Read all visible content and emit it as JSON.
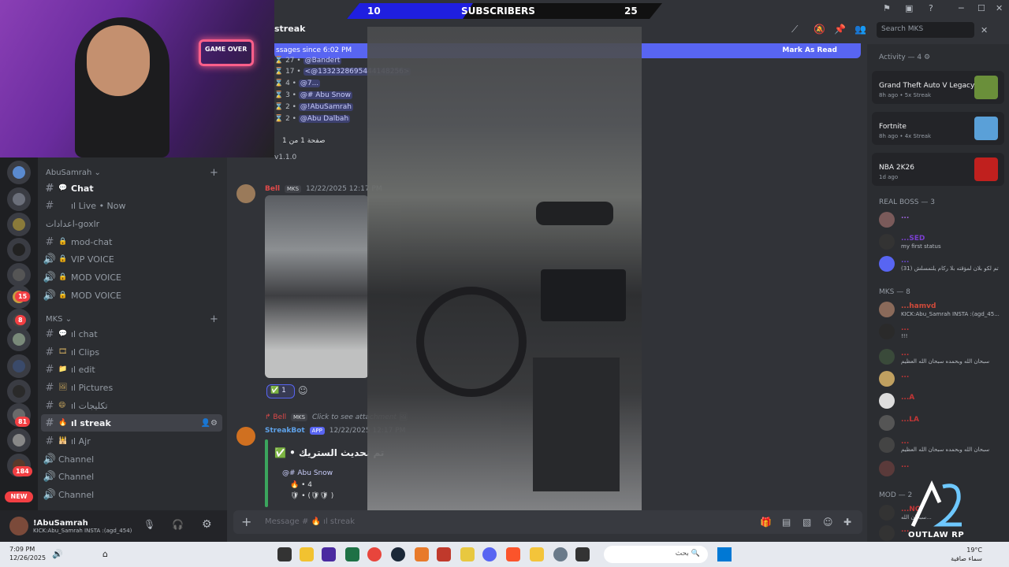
{
  "stream": {
    "subscribers": {
      "label": "SUBSCRIBERS",
      "current": "10",
      "goal": "25",
      "progress_fraction": 0.4
    },
    "logo_text": "OUTLAW RP",
    "neon_sign": "GAME OVER"
  },
  "window": {
    "search_placeholder": "Search MKS"
  },
  "channel_header": {
    "name": "streak"
  },
  "new_messages": {
    "text": "ssages since 6:02 PM",
    "action": "Mark As Read"
  },
  "leaderboard": [
    {
      "rank": "27",
      "name": "@Bandert"
    },
    {
      "rank": "17",
      "name": "<@1332328695444148256>"
    },
    {
      "rank": "4",
      "name": "@7..."
    },
    {
      "rank": "3",
      "name": "@# Abu Snow"
    },
    {
      "rank": "2",
      "name": "@!AbuSamrah"
    },
    {
      "rank": "2",
      "name": "@Abu Dalbah"
    }
  ],
  "leaderboard_page": "صفحة 1 من 1",
  "leaderboard_version": "v1.1.0",
  "messages": [
    {
      "author": "Bell",
      "tag": "MKS",
      "time": "12/22/2025 12:17 PM",
      "reaction_count": "1"
    },
    {
      "author": "StreakBot",
      "app_tag": "APP",
      "time": "12/22/2025 12:17 PM",
      "reply_tag": "MKS",
      "reply_text": "Click to see attachment",
      "title": "تم تحديث الستريك",
      "mention": "@# Abu Snow",
      "line1": "4",
      "line2": ")"
    }
  ],
  "sidebar": {
    "server_badges": [
      "15",
      "8",
      "81",
      "184"
    ],
    "new_label": "NEW",
    "category1": "AbuSamrah",
    "category2": "MKS",
    "channels": [
      {
        "label": "Chat",
        "prefix": "💬",
        "bold": true
      },
      {
        "label": "ıl Live • Now",
        "prefix": "",
        "bold": false
      },
      {
        "label": "اعدادات-goxlr",
        "prefix": "",
        "bold": false
      },
      {
        "label": "mod-chat",
        "prefix": "🔒",
        "bold": false
      },
      {
        "label": "VIP VOICE",
        "prefix": "🔒",
        "bold": false
      },
      {
        "label": "MOD VOICE",
        "prefix": "🔒",
        "bold": false
      },
      {
        "label": "MOD VOICE",
        "prefix": "🔒",
        "bold": false
      }
    ],
    "channels2": [
      {
        "label": "ıl chat",
        "prefix": "💬"
      },
      {
        "label": "ıl Clips",
        "prefix": "🎞"
      },
      {
        "label": "ıl edit",
        "prefix": "📁"
      },
      {
        "label": "ıl Pictures",
        "prefix": "🖼"
      },
      {
        "label": "ıl تكليجات",
        "prefix": "😄"
      },
      {
        "label": "ıl streak",
        "prefix": "🔥"
      },
      {
        "label": "ıl Ajr",
        "prefix": "🕌"
      },
      {
        "label": "Channel",
        "prefix": ""
      },
      {
        "label": "Channel",
        "prefix": ""
      },
      {
        "label": "Channel",
        "prefix": ""
      }
    ]
  },
  "user": {
    "name": "!AbuSamrah",
    "status": "KICK:Abu_Samrah INSTA :(agd_454)"
  },
  "composer": {
    "placeholder": "Message # 🔥 ıl streak"
  },
  "activity": {
    "header": "Activity — 4",
    "games": [
      {
        "title": "Grand Theft Auto V Legacy",
        "meta": "8h ago • 5x Streak",
        "color": "#6a8f3a"
      },
      {
        "title": "Fortnite",
        "meta": "8h ago • 4x Streak",
        "color": "#5aa0d8"
      },
      {
        "title": "NBA 2K26",
        "meta": "1d ago",
        "color": "#c0201e"
      }
    ]
  },
  "groups": [
    {
      "name": "REAL BOSS — 3",
      "members": [
        {
          "name": "...",
          "status": "",
          "color": "#a066e0"
        },
        {
          "name": "...SED",
          "status": "my first status",
          "color": "#7b3fd0"
        },
        {
          "name": "...",
          "status": "(31) تم لكو بلان لمؤقته بلا ركام يلتمسلش",
          "color": "#6d49d8"
        }
      ]
    },
    {
      "name": "MKS — 8",
      "members": [
        {
          "name": "...hamvd",
          "status": "KICK:Abu_Samrah INSTA :(agd_45...",
          "color": "#d04a3a"
        },
        {
          "name": "...",
          "status": "!!!",
          "color": "#c23636"
        },
        {
          "name": "...",
          "status": "سبحان الله وبحمده سبحان الله العظيم",
          "color": "#c23636"
        },
        {
          "name": "...",
          "status": "",
          "color": "#c23636"
        },
        {
          "name": "...A",
          "status": "",
          "color": "#c23636"
        },
        {
          "name": "...LA",
          "status": "",
          "color": "#c23636"
        },
        {
          "name": "...",
          "status": "سبحان الله وبحمده سبحان الله العظيم",
          "color": "#c23636"
        },
        {
          "name": "...",
          "status": "",
          "color": "#c23636"
        }
      ]
    },
    {
      "name": "MOD — 2",
      "members": [
        {
          "name": "...NQ",
          "status": "سبحان الله...",
          "color": "#c23636"
        },
        {
          "name": "...",
          "status": "",
          "color": "#c23636"
        }
      ]
    }
  ],
  "taskbar": {
    "time": "7:09 PM",
    "date": "12/26/2025",
    "search": "بحث",
    "temperature": "19°C",
    "weather": "سماء صافية"
  }
}
